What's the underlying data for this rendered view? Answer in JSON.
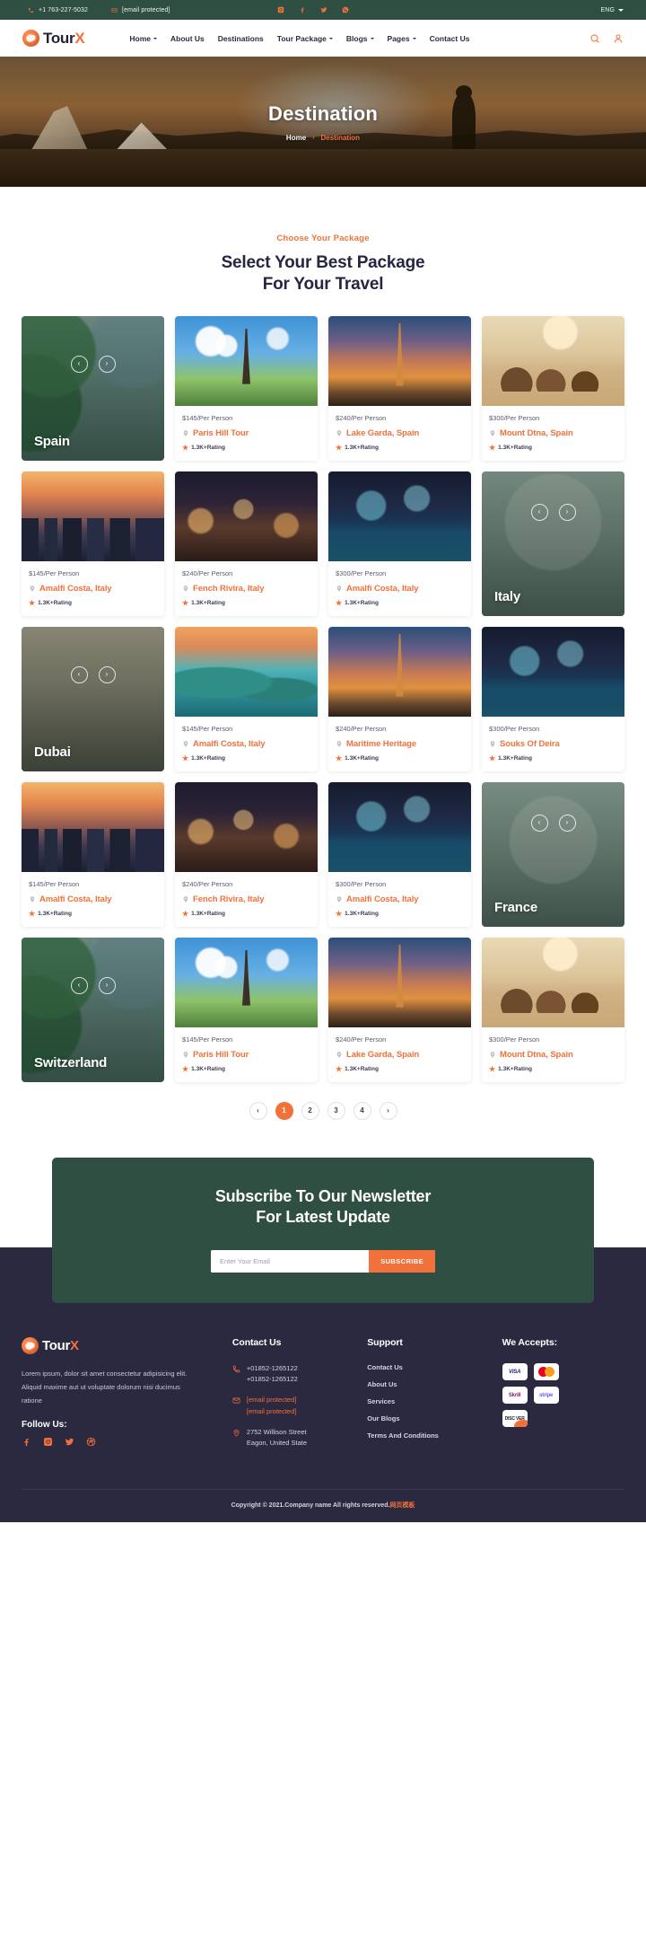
{
  "topbar": {
    "phone": "+1 763-227-5032",
    "email": "[email protected]",
    "socials": [
      "instagram-icon",
      "facebook-icon",
      "twitter-icon",
      "whatsapp-icon"
    ],
    "language": "ENG"
  },
  "nav": {
    "brand": "Tour",
    "brand_accent": "X",
    "menu": [
      {
        "label": "Home",
        "caret": true
      },
      {
        "label": "About Us",
        "caret": false
      },
      {
        "label": "Destinations",
        "caret": false
      },
      {
        "label": "Tour Package",
        "caret": true
      },
      {
        "label": "Blogs",
        "caret": true
      },
      {
        "label": "Pages",
        "caret": true
      },
      {
        "label": "Contact Us",
        "caret": false
      }
    ],
    "icons": [
      "search-icon",
      "user-icon"
    ]
  },
  "hero": {
    "title": "Destination",
    "breadcrumb_home": "Home",
    "breadcrumb_sep": "›",
    "breadcrumb_current": "Destination"
  },
  "section": {
    "eyebrow": "Choose Your Package",
    "title_line1": "Select Your Best Package",
    "title_line2": "For Your Travel"
  },
  "slides": [
    {
      "name": "Spain",
      "photo": "ph-jungle",
      "prev": "‹",
      "next": "›"
    },
    {
      "name": "Italy",
      "photo": "ph-colosseum",
      "prev": "‹",
      "next": "›"
    },
    {
      "name": "Dubai",
      "photo": "ph-dune",
      "prev": "‹",
      "next": "›"
    },
    {
      "name": "France",
      "photo": "ph-palace",
      "prev": "‹",
      "next": "›"
    },
    {
      "name": "Switzerland",
      "photo": "ph-jungle",
      "prev": "‹",
      "next": "›"
    }
  ],
  "per_person": "/Per Person",
  "rating_label": "1.3K+Rating",
  "rows": [
    {
      "slide_index": 0,
      "slide_position": "left",
      "cards": [
        {
          "price": "$145",
          "unit": "/Per Person",
          "place": "Paris Hill Tour",
          "rating": "1.3K+Rating",
          "photo": "ph-eiffel"
        },
        {
          "price": "$240",
          "unit": "/Per Person",
          "place": "Lake Garda, Spain",
          "rating": "1.3K+Rating",
          "photo": "ph-tower-dusk"
        },
        {
          "price": "$300",
          "unit": "/Per Person",
          "place": "Mount Dtna, Spain",
          "rating": "1.3K+Rating",
          "photo": "ph-desert"
        }
      ]
    },
    {
      "slide_index": 1,
      "slide_position": "right",
      "cards": [
        {
          "price": "$145",
          "unit": "/Per Person",
          "place": "Amalfi Costa, Italy",
          "rating": "1.3K+Rating",
          "photo": "ph-city-dusk"
        },
        {
          "price": "$240",
          "unit": "/Per Person",
          "place": "Fench Rivira, Italy",
          "rating": "1.3K+Rating",
          "photo": "ph-night-city"
        },
        {
          "price": "$300",
          "unit": "/Per Person",
          "place": "Amalfi Costa, Italy",
          "rating": "1.3K+Rating",
          "photo": "ph-marina"
        }
      ]
    },
    {
      "slide_index": 2,
      "slide_position": "left",
      "cards": [
        {
          "price": "$145",
          "unit": "/Per Person",
          "place": "Amalfi Costa, Italy",
          "rating": "1.3K+Rating",
          "photo": "ph-island"
        },
        {
          "price": "$240",
          "unit": "/Per Person",
          "place": "Maritime Heritage",
          "rating": "1.3K+Rating",
          "photo": "ph-tower-dusk"
        },
        {
          "price": "$300",
          "unit": "/Per Person",
          "place": "Souks Of Deira",
          "rating": "1.3K+Rating",
          "photo": "ph-marina"
        }
      ]
    },
    {
      "slide_index": 3,
      "slide_position": "right",
      "cards": [
        {
          "price": "$145",
          "unit": "/Per Person",
          "place": "Amalfi Costa, Italy",
          "rating": "1.3K+Rating",
          "photo": "ph-city-dusk"
        },
        {
          "price": "$240",
          "unit": "/Per Person",
          "place": "Fench Rivira, Italy",
          "rating": "1.3K+Rating",
          "photo": "ph-night-city"
        },
        {
          "price": "$300",
          "unit": "/Per Person",
          "place": "Amalfi Costa, Italy",
          "rating": "1.3K+Rating",
          "photo": "ph-marina"
        }
      ]
    },
    {
      "slide_index": 4,
      "slide_position": "left",
      "cards": [
        {
          "price": "$145",
          "unit": "/Per Person",
          "place": "Paris Hill Tour",
          "rating": "1.3K+Rating",
          "photo": "ph-eiffel"
        },
        {
          "price": "$240",
          "unit": "/Per Person",
          "place": "Lake Garda, Spain",
          "rating": "1.3K+Rating",
          "photo": "ph-tower-dusk"
        },
        {
          "price": "$300",
          "unit": "/Per Person",
          "place": "Mount Dtna, Spain",
          "rating": "1.3K+Rating",
          "photo": "ph-desert"
        }
      ]
    }
  ],
  "pagination": {
    "prev": "‹",
    "pages": [
      "1",
      "2",
      "3",
      "4"
    ],
    "active": "1",
    "next": "›"
  },
  "newsletter": {
    "title_line1": "Subscribe To Our Newsletter",
    "title_line2": "For Latest Update",
    "placeholder": "Enter Your Email",
    "value": "",
    "button": "SUBSCRIBE"
  },
  "footer": {
    "brand": "Tour",
    "brand_accent": "X",
    "about": "Lorem ipsum, dolor sit amet consectetur adipisicing elit. Aliquid maxime aut ut voluptate dolorum nisi ducimus ratione",
    "follow_label": "Follow Us:",
    "social_icons": [
      "facebook-icon",
      "instagram-icon",
      "twitter-icon",
      "dribbble-icon"
    ],
    "contact_head": "Contact Us",
    "phone1": "+01852-1265122",
    "phone2": "+01852-1265122",
    "email1": "[email protected]",
    "email2": "[email protected]",
    "address1": "2752 Willison Street",
    "address2": "Eagon, United State",
    "support_head": "Support",
    "support_links": [
      "Contact Us",
      "About Us",
      "Services",
      "Our Blogs",
      "Terms And Conditions"
    ],
    "payments_head": "We Accepts:",
    "payments": [
      {
        "name": "visa",
        "label": "VISA"
      },
      {
        "name": "mastercard",
        "label": ""
      },
      {
        "name": "skrill",
        "label": "Skrill"
      },
      {
        "name": "stripe",
        "label": "stripe"
      },
      {
        "name": "discover",
        "label": "DISC VER"
      }
    ],
    "copyright": "Copyright © 2021.Company name All rights reserved.",
    "copyright_cn": "网页模板"
  },
  "colors": {
    "accent": "#f2713a",
    "dark_green": "#2e4f42",
    "footer_navy": "#2b2940",
    "heading": "#262641"
  }
}
